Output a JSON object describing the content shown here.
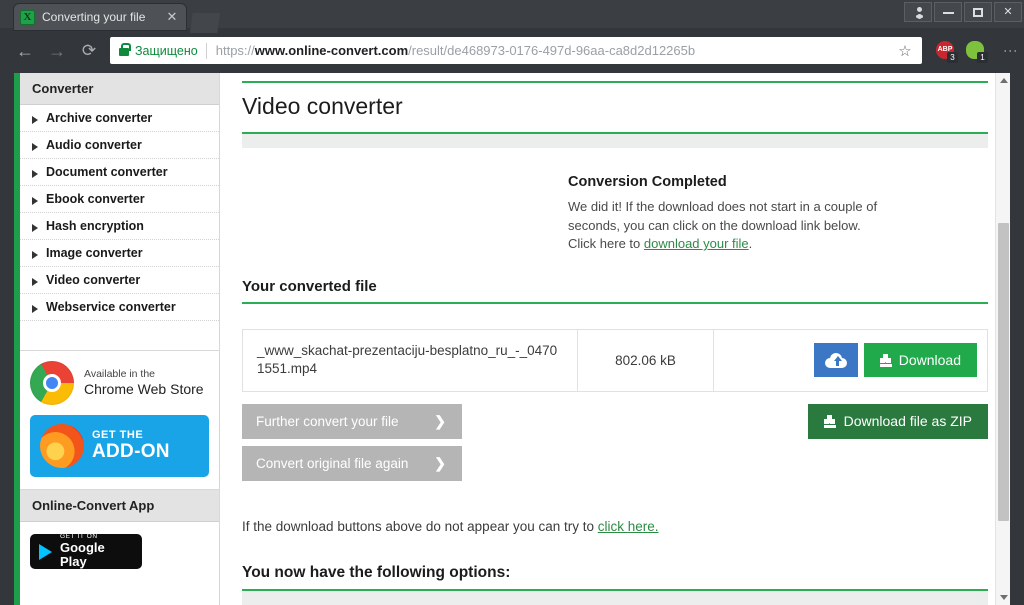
{
  "window": {
    "controls": {
      "profile_icon": "user-icon",
      "minimize": "–",
      "maximize": "□",
      "close": "✕"
    }
  },
  "browser": {
    "tab": {
      "title": "Converting your file",
      "favicon": "green-x-favicon",
      "close_label": "✕"
    },
    "new_tab_label": "",
    "nav": {
      "back": "←",
      "forward": "→",
      "reload": "⟳"
    },
    "omnibox": {
      "security_label": "Защищено",
      "url_scheme": "https://",
      "url_host": "www.online-convert.com",
      "url_path": "/result/de468973-0176-497d-96aa-ca8d2d12265b",
      "star_icon": "☆"
    },
    "extensions": [
      {
        "name": "adblock-plus",
        "label": "ABP",
        "badge": "3"
      },
      {
        "name": "extension-green",
        "label": "",
        "badge": "1"
      }
    ],
    "menu_icon": "⋮"
  },
  "sidebar": {
    "heading": "Converter",
    "items": [
      {
        "label": "Archive converter"
      },
      {
        "label": "Audio converter"
      },
      {
        "label": "Document converter"
      },
      {
        "label": "Ebook converter"
      },
      {
        "label": "Hash encryption"
      },
      {
        "label": "Image converter"
      },
      {
        "label": "Video converter"
      },
      {
        "label": "Webservice converter"
      }
    ],
    "chrome_web_store": {
      "line1": "Available in the",
      "line2": "Chrome Web Store"
    },
    "firefox_addon": {
      "line1": "GET THE",
      "line2": "ADD-ON"
    },
    "app_heading": "Online-Convert App",
    "google_play": {
      "line1": "GET IT ON",
      "line2": "Google Play"
    }
  },
  "main": {
    "page_title": "Video converter",
    "completed": {
      "heading": "Conversion Completed",
      "body_line1": "We did it! If the download does not start in a couple of",
      "body_line2": "seconds, you can click on the download link below.",
      "body_line3_prefix": "Click here to ",
      "body_link": "download your file",
      "body_line3_suffix": "."
    },
    "converted_section_title": "Your converted file",
    "file": {
      "name": "_www_skachat-prezentaciju-besplatno_ru_-_04701551.mp4",
      "size": "802.06 kB",
      "cloud_icon": "cloud-upload-icon",
      "download_label": "Download",
      "download_icon": "download-icon"
    },
    "actions": {
      "further_convert": "Further convert your file",
      "convert_again": "Convert original file again",
      "chevron": "❯",
      "zip_label": "Download file as ZIP",
      "zip_icon": "download-icon"
    },
    "hint_prefix": "If the download buttons above do not appear you can try to ",
    "hint_link": "click here.",
    "options_title": "You now have the following options:"
  },
  "colors": {
    "brand_green": "#2aad54",
    "rail_green": "#1e9e4a",
    "download_green": "#20aa4b",
    "zip_green": "#2a7a3f",
    "cloud_blue": "#3b77c4",
    "gray_button": "#b5b5b5"
  }
}
